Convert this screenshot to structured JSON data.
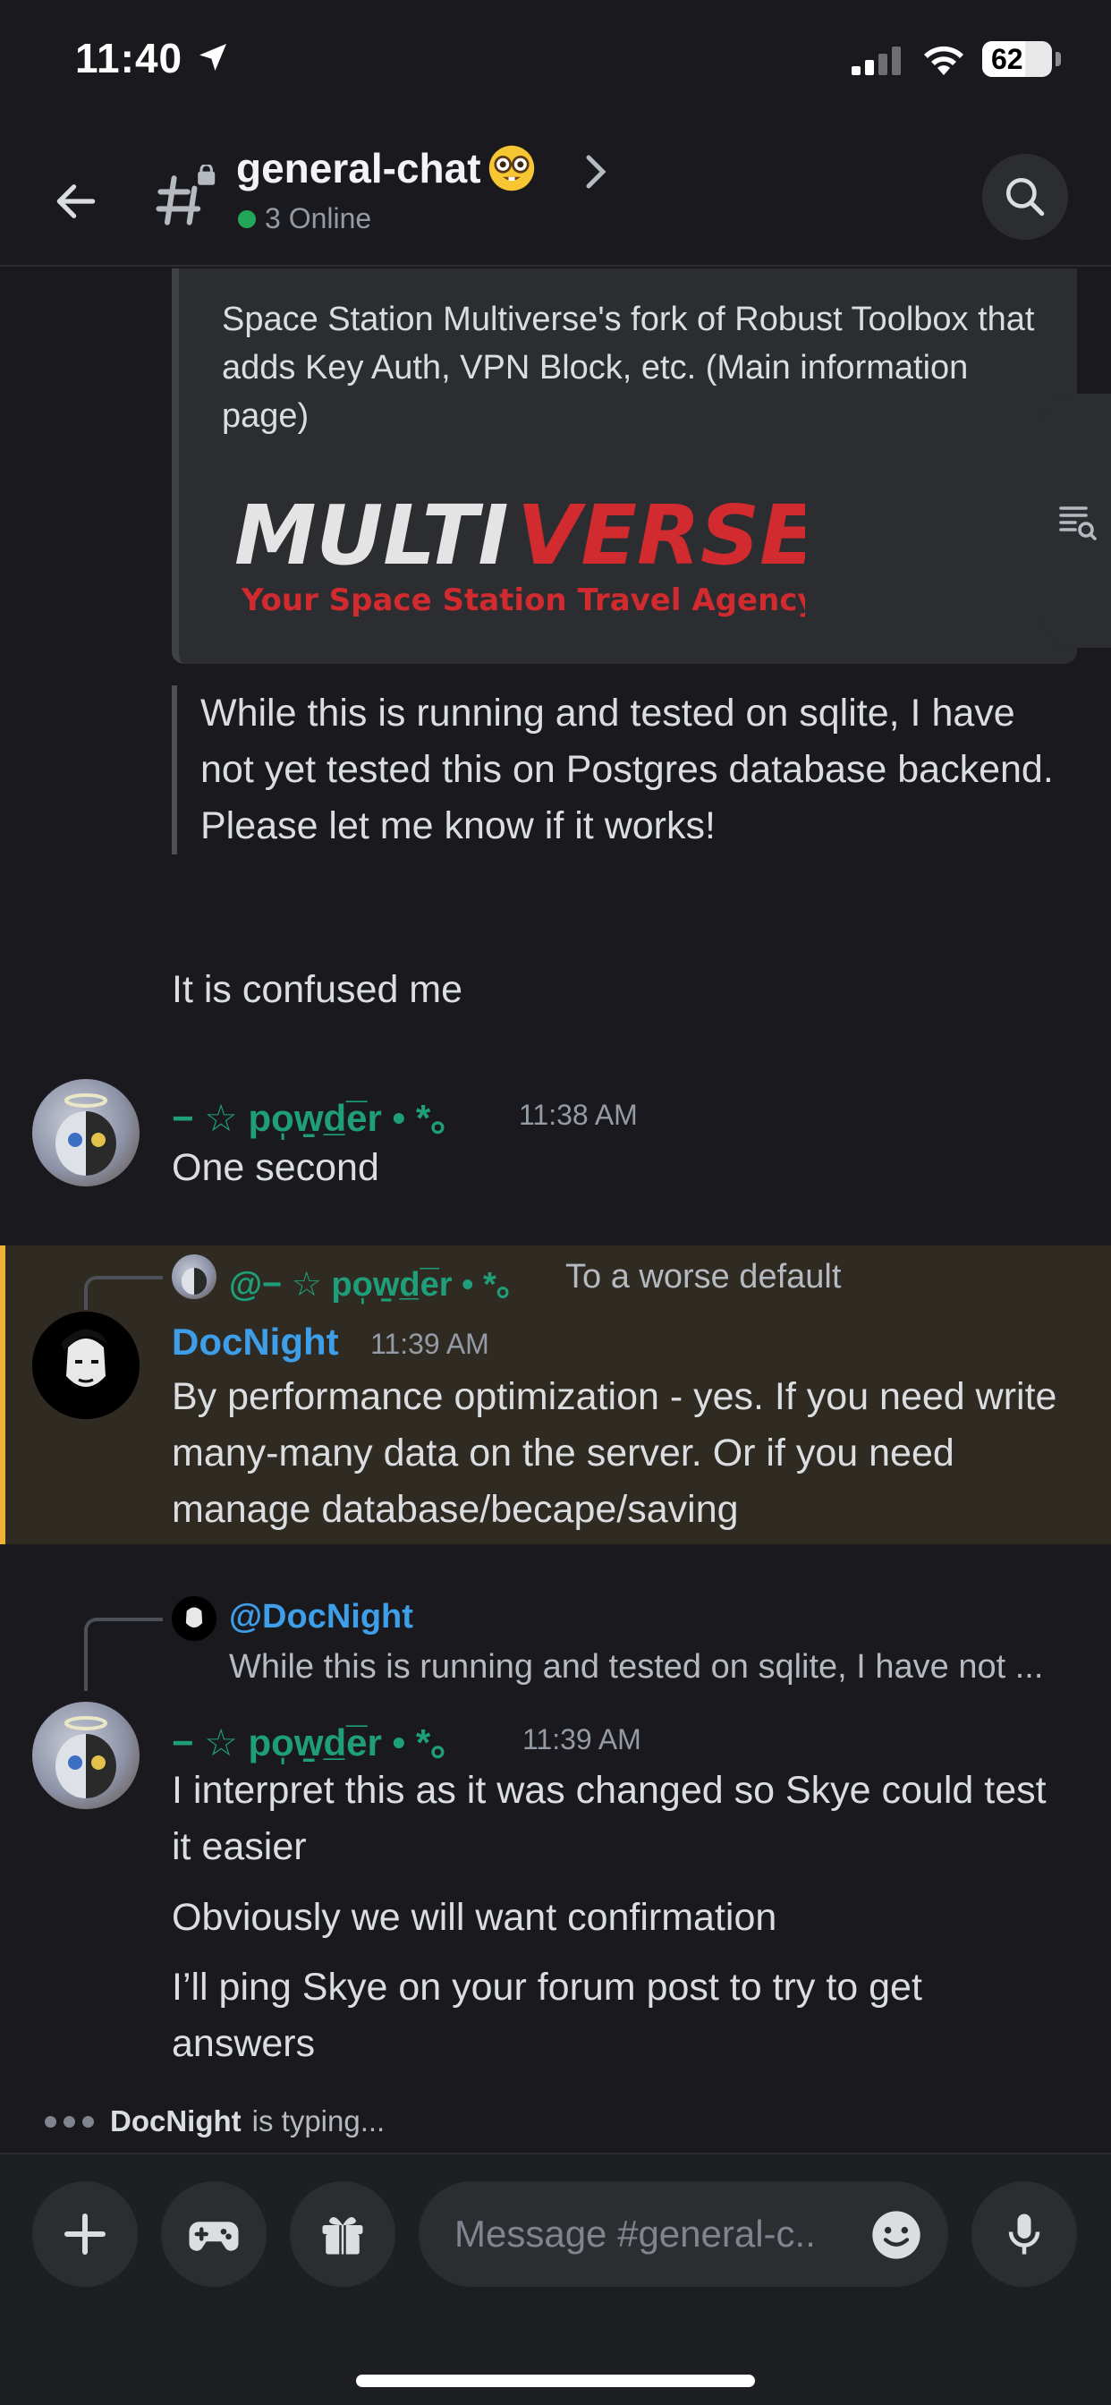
{
  "status_bar": {
    "time": "11:40",
    "battery": "62"
  },
  "header": {
    "channel_name": "general-chat",
    "online_text": "3 Online"
  },
  "embed": {
    "description": "Space Station Multiverse's fork of Robust Toolbox that adds Key Auth, VPN Block, etc.  (Main information page)",
    "logo_main_a": "MULTI",
    "logo_main_b": "VERSE",
    "logo_tagline": "Your Space Station Travel Agency"
  },
  "quote_text": "While this is running and tested on sqlite, I have not yet tested this on Postgres database backend. Please let me know if it works!",
  "plain_message": "It is confused me",
  "messages": [
    {
      "author": "− ☆ po̩w̱d̲e̅r • *。",
      "time": "11:38 AM",
      "lines": [
        "One second"
      ]
    },
    {
      "reply_to": "@− ☆ po̩w̱d̲e̅r • *。",
      "reply_preview": "To a worse default",
      "author": "DocNight",
      "time": "11:39 AM",
      "lines": [
        "By performance optimization - yes. If you need write many-many data on the server. Or if you need manage database/becape/saving"
      ]
    },
    {
      "reply_to": "@DocNight",
      "reply_preview": "While this is running and tested on sqlite, I have not ...",
      "author": "− ☆ po̩w̱d̲e̅r • *。",
      "time": "11:39 AM",
      "lines": [
        "I interpret this as it was changed so Skye could test it easier",
        "Obviously we will want confirmation",
        "I’ll ping Skye on your forum post to try to get answers"
      ]
    }
  ],
  "typing": {
    "user": "DocNight",
    "suffix": "is typing..."
  },
  "composer": {
    "placeholder": "Message #general-c.."
  },
  "colors": {
    "accent_green": "#1f9e7a",
    "accent_blue": "#3e9ee8",
    "highlight_bar": "#f0b232"
  }
}
